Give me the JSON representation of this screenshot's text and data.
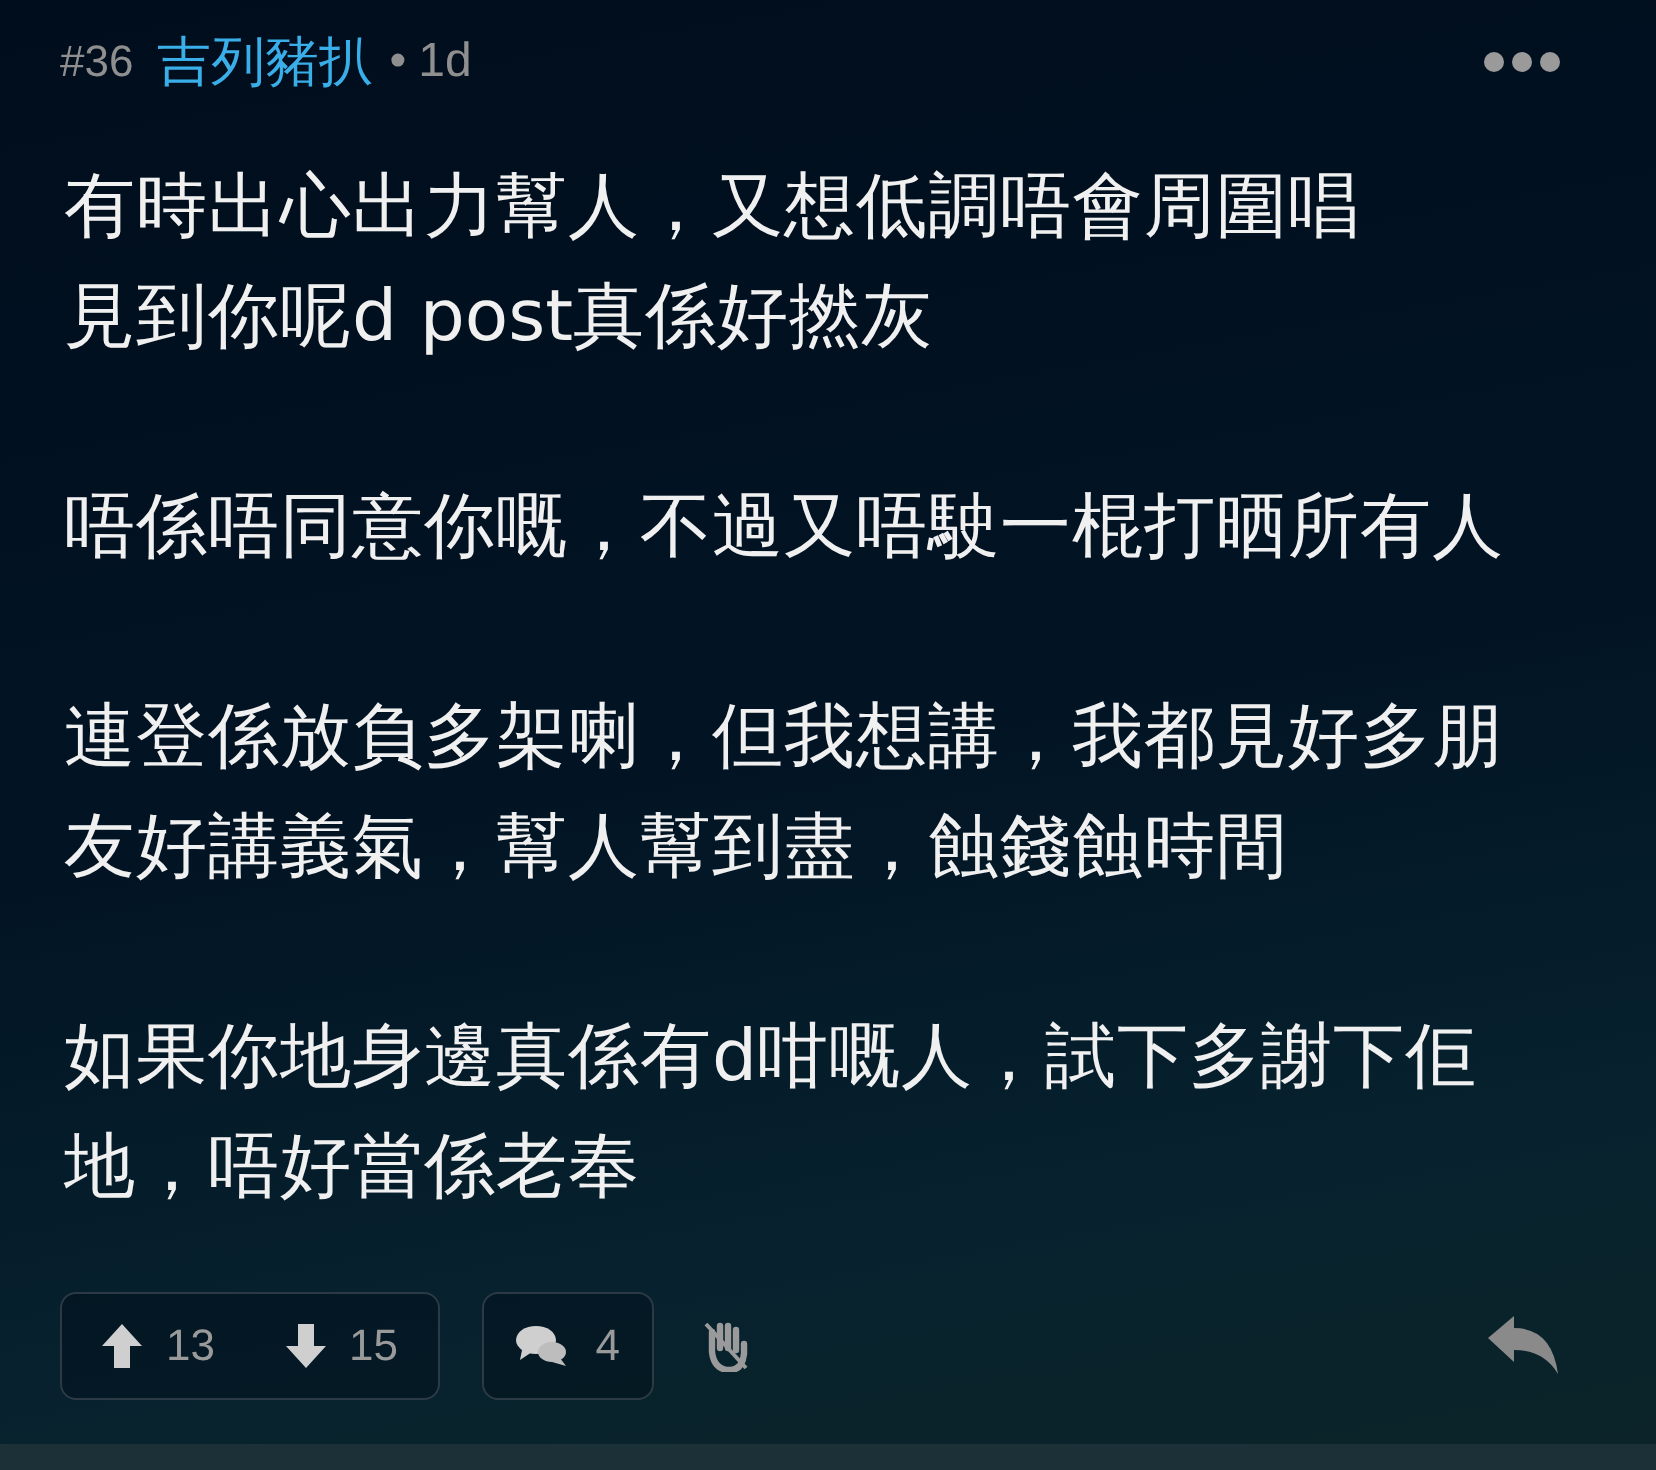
{
  "post": {
    "number": "#36",
    "author": "吉列豬扒",
    "separator": "•",
    "age": "1d"
  },
  "paragraphs": [
    [
      "有時出心出力幫人，又想低調唔會周圍唱",
      "見到你呢d post真係好撚灰"
    ],
    [
      "唔係唔同意你嘅，不過又唔駛一棍打晒所有人"
    ],
    [
      "連登係放負多架喇，但我想講，我都見好多朋",
      "友好講義氣，幫人幫到盡，蝕錢蝕時間"
    ],
    [
      "如果你地身邊真係有d咁嘅人，試下多謝下佢",
      "地，唔好當係老奉"
    ]
  ],
  "actions": {
    "upvotes": "13",
    "downvotes": "15",
    "comments": "4"
  }
}
